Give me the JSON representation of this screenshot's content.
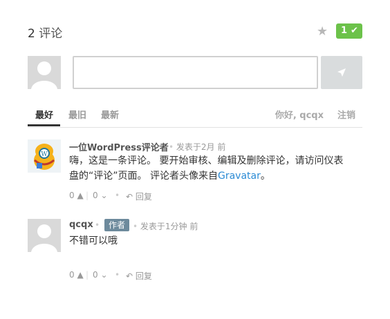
{
  "header": {
    "count": "2",
    "count_label": "评论",
    "fav_count": "1"
  },
  "composer": {
    "placeholder": ""
  },
  "tabs": [
    {
      "label": "最好"
    },
    {
      "label": "最旧"
    },
    {
      "label": "最新"
    }
  ],
  "user": {
    "greeting": "你好, qcqx",
    "logout": "注销"
  },
  "comments": [
    {
      "author": "一位WordPress评论者",
      "meta": "发表于2月 前",
      "text_line1": "嗨，这是一条评论。 要开始审核、编辑及删除评论，请访问仪表",
      "text_line2_pre": "盘的“评论”页面。 评论者头像来自",
      "text_link": "Gravatar",
      "text_line2_post": "。",
      "likes": "0",
      "dislikes": "0",
      "reply": "回复"
    },
    {
      "author": "qcqx",
      "badge": "作者",
      "meta": "发表于1分钟 前",
      "text": "不错可以哦",
      "likes": "0",
      "dislikes": "0",
      "reply": "回复"
    }
  ],
  "colors": {
    "accent_green": "#6cc24a",
    "badge_gray": "#6d8a9c",
    "link_blue": "#2a8ad4"
  },
  "icons": [
    "star-icon",
    "check-icon",
    "send-icon",
    "thumbs-up-icon",
    "thumbs-down-icon",
    "reply-icon",
    "default-avatar-icon",
    "wapuu-avatar-icon"
  ]
}
